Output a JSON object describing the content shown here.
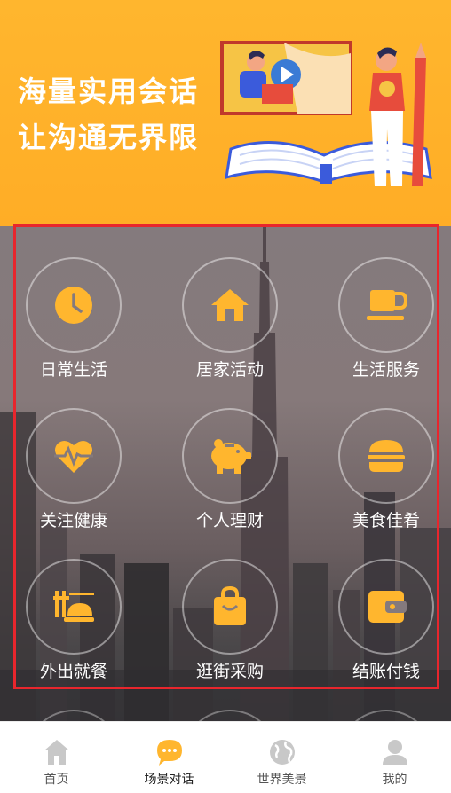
{
  "banner": {
    "line1": "海量实用会话",
    "line2": "让沟通无界限"
  },
  "grid": [
    {
      "label": "日常生活",
      "icon": "clock-icon"
    },
    {
      "label": "居家活动",
      "icon": "house-icon"
    },
    {
      "label": "生活服务",
      "icon": "coffee-cup-icon"
    },
    {
      "label": "关注健康",
      "icon": "heartbeat-icon"
    },
    {
      "label": "个人理财",
      "icon": "piggy-bank-icon"
    },
    {
      "label": "美食佳肴",
      "icon": "burger-icon"
    },
    {
      "label": "外出就餐",
      "icon": "dining-icon"
    },
    {
      "label": "逛街采购",
      "icon": "shopping-bag-icon"
    },
    {
      "label": "结账付钱",
      "icon": "wallet-icon"
    }
  ],
  "tabs": [
    {
      "label": "首页",
      "icon": "home-icon"
    },
    {
      "label": "场景对话",
      "icon": "chat-bubble-icon",
      "active": true
    },
    {
      "label": "世界美景",
      "icon": "globe-icon"
    },
    {
      "label": "我的",
      "icon": "user-icon"
    }
  ],
  "colors": {
    "accent": "#ffb62e",
    "highlight": "#e8262d",
    "icon_inactive": "#c8c8c8"
  }
}
